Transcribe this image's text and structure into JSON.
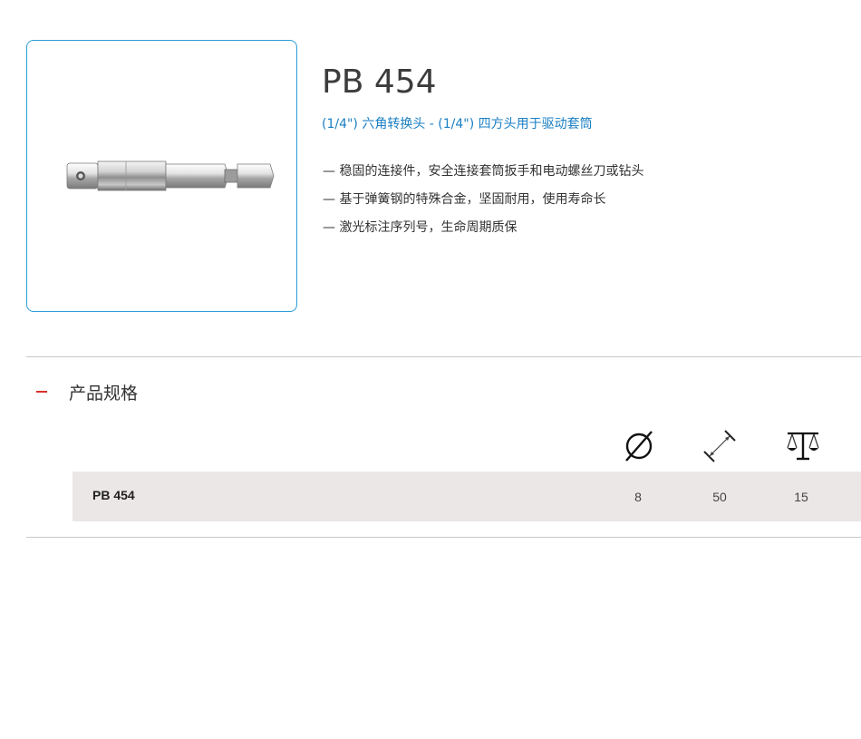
{
  "product": {
    "title": "PB 454",
    "subtitle": "(1/4\") 六角转换头 - (1/4\") 四方头用于驱动套筒",
    "features": [
      "— 稳固的连接件，安全连接套筒扳手和电动螺丝刀或钻头",
      "— 基于弹簧钢的特殊合金，坚固耐用，使用寿命长",
      "— 激光标注序列号，生命周期质保"
    ],
    "image_icon": "hex-to-square-drive-adapter",
    "frame_color": "#2a9fd6"
  },
  "specs": {
    "section_title": "产品规格",
    "toggle_icon": "minus-collapse-icon",
    "toggle_color": "#d9302c",
    "columns": [
      {
        "icon": "diameter-icon"
      },
      {
        "icon": "length-icon"
      },
      {
        "icon": "weight-scale-icon"
      }
    ],
    "rows": [
      {
        "name": "PB 454",
        "values": [
          "8",
          "50",
          "15"
        ]
      }
    ]
  }
}
